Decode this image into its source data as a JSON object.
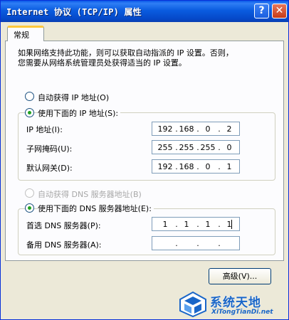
{
  "window": {
    "title": "Internet 协议 (TCP/IP) 属性",
    "help_label": "?",
    "close_label": "✕"
  },
  "tabs": [
    {
      "label": "常规"
    }
  ],
  "intro": {
    "line1": "如果网络支持此功能，则可以获取自动指派的 IP 设置。否则，",
    "line2": "您需要从网络系统管理员处获得适当的 IP 设置。"
  },
  "ip": {
    "auto_label": "自动获得 IP 地址(O)",
    "manual_label": "使用下面的 IP 地址(S):",
    "selected": "manual",
    "fields": [
      {
        "label": "IP 地址(I):",
        "octets": [
          "192",
          "168",
          "0",
          "2"
        ]
      },
      {
        "label": "子网掩码(U):",
        "octets": [
          "255",
          "255",
          "255",
          "0"
        ]
      },
      {
        "label": "默认网关(D):",
        "octets": [
          "192",
          "168",
          "0",
          "1"
        ]
      }
    ]
  },
  "dns": {
    "auto_label": "自动获得 DNS 服务器地址(B)",
    "auto_enabled": false,
    "manual_label": "使用下面的 DNS 服务器地址(E):",
    "selected": "manual",
    "fields": [
      {
        "label": "首选 DNS 服务器(P):",
        "octets": [
          "1",
          "1",
          "1",
          "1"
        ]
      },
      {
        "label": "备用 DNS 服务器(A):",
        "octets": [
          "",
          "",
          "",
          ""
        ]
      }
    ]
  },
  "advanced_button": "高级(V)...",
  "watermark": {
    "text": "系统天地",
    "sub": "XiTongTianDi.net",
    "accent": "#1a66c8"
  },
  "colors": {
    "titlebar": "#0a5ce0",
    "dialog_bg": "#ece9d8",
    "radio_dot": "#21a121",
    "tab_highlight": "#ffc83c"
  }
}
